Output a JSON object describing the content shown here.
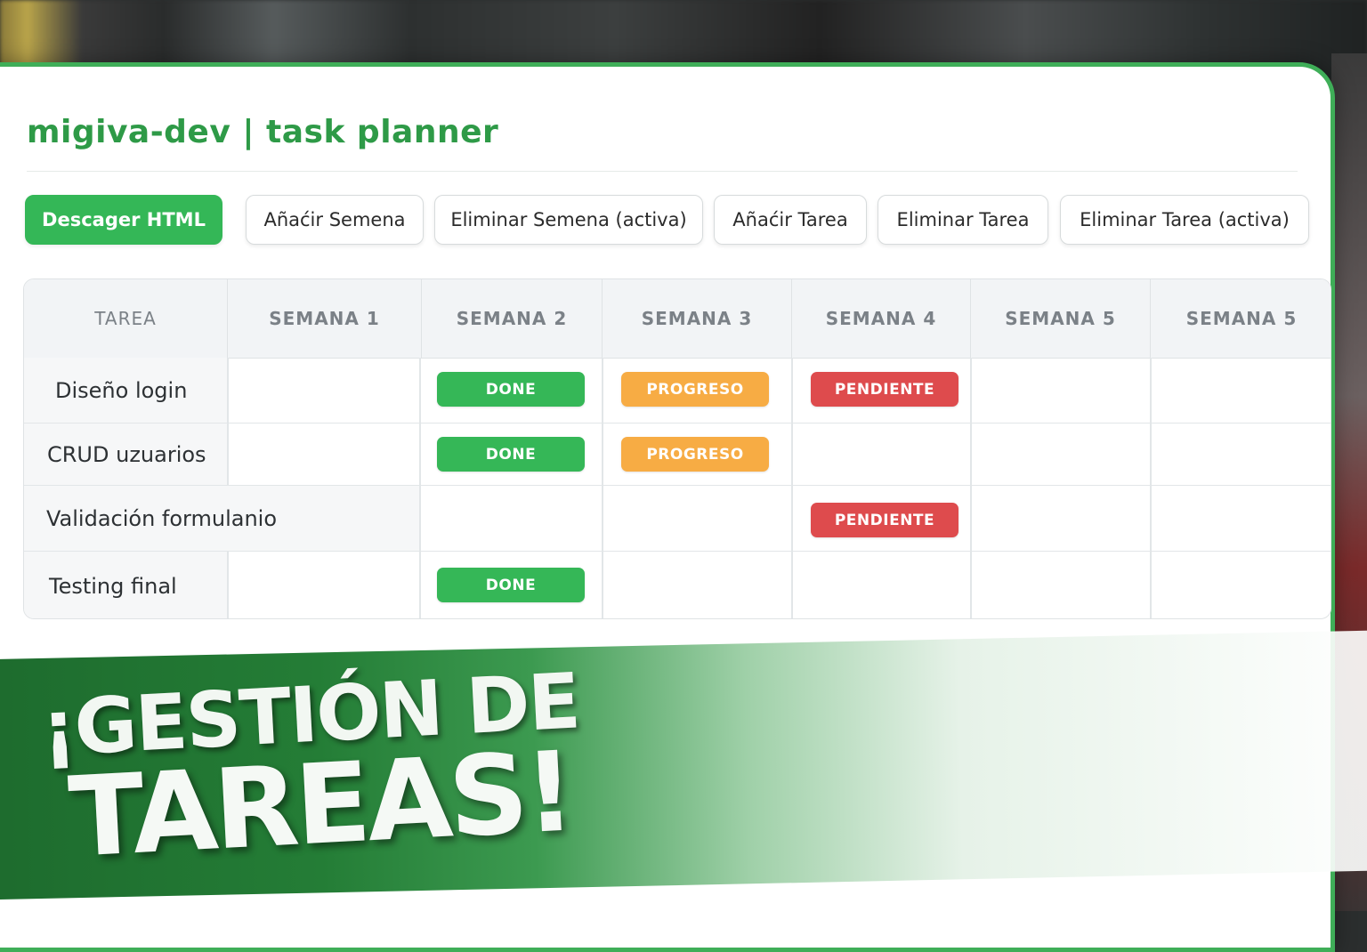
{
  "app": {
    "title": "migiva-dev | task planner"
  },
  "toolbar": {
    "download": "Descager HTML",
    "add_week": "Añaćir Semena",
    "delete_week_active": "Eliminar Semena (activa)",
    "add_task": "Añaćir Tarea",
    "delete_task": "Eliminar Tarea",
    "delete_task_active": "Eliminar Tarea (activa)"
  },
  "table": {
    "headers": [
      "TAREA",
      "SEMANA 1",
      "SEMANA 2",
      "SEMANA 3",
      "SEMANA 4",
      "SEMANA 5",
      "SEMANA 5"
    ],
    "rows": [
      {
        "task": "Diseño login",
        "cells": [
          "",
          "DONE",
          "PROGRESO",
          "PENDIENTE",
          "",
          ""
        ]
      },
      {
        "task": "CRUD uzuarios",
        "cells": [
          "",
          "DONE",
          "PROGRESO",
          "",
          "",
          ""
        ]
      },
      {
        "task": "Validación formulanio",
        "cells": [
          "",
          "",
          "",
          "PENDIENTE",
          "",
          ""
        ]
      },
      {
        "task": "Testing final",
        "cells": [
          "",
          "DONE",
          "",
          "",
          "",
          ""
        ]
      }
    ]
  },
  "banner": {
    "line1": "¡GESTIÓN DE",
    "line2": "TAREAS!"
  },
  "colors": {
    "accent": "#2e9a47",
    "done": "#35b757",
    "progress": "#f7ac44",
    "pending": "#de4b4d"
  }
}
